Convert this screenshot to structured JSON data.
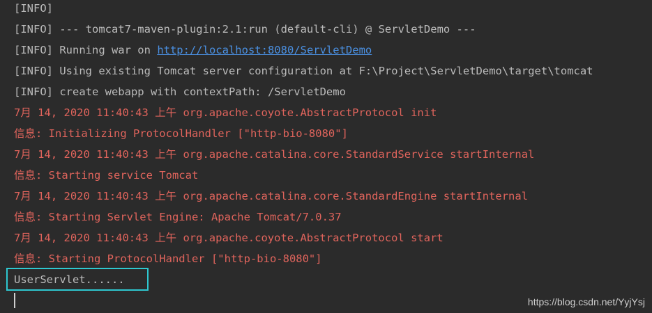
{
  "console": {
    "lines": [
      {
        "text": "[INFO]"
      },
      {
        "text": "[INFO] --- tomcat7-maven-plugin:2.1:run (default-cli) @ ServletDemo ---"
      },
      {
        "prefix": "[INFO] Running war on ",
        "link": "http://localhost:8080/ServletDemo"
      },
      {
        "text": "[INFO] Using existing Tomcat server configuration at F:\\Project\\ServletDemo\\target\\tomcat"
      },
      {
        "text": "[INFO] create webapp with contextPath: /ServletDemo"
      },
      {
        "text": "7月 14, 2020 11:40:43 上午 org.apache.coyote.AbstractProtocol init"
      },
      {
        "text": "信息: Initializing ProtocolHandler [\"http-bio-8080\"]"
      },
      {
        "text": "7月 14, 2020 11:40:43 上午 org.apache.catalina.core.StandardService startInternal"
      },
      {
        "text": "信息: Starting service Tomcat"
      },
      {
        "text": "7月 14, 2020 11:40:43 上午 org.apache.catalina.core.StandardEngine startInternal"
      },
      {
        "text": "信息: Starting Servlet Engine: Apache Tomcat/7.0.37"
      },
      {
        "text": "7月 14, 2020 11:40:43 上午 org.apache.coyote.AbstractProtocol start"
      },
      {
        "text": "信息: Starting ProtocolHandler [\"http-bio-8080\"]"
      },
      {
        "text": "UserServlet......"
      }
    ]
  },
  "watermark": "https://blog.csdn.net/YyjYsj",
  "colors": {
    "background": "#2b2b2b",
    "info_text": "#bbbbbb",
    "error_text": "#e0645c",
    "link": "#4a8fe0",
    "highlight_border": "#2ec8d0"
  }
}
